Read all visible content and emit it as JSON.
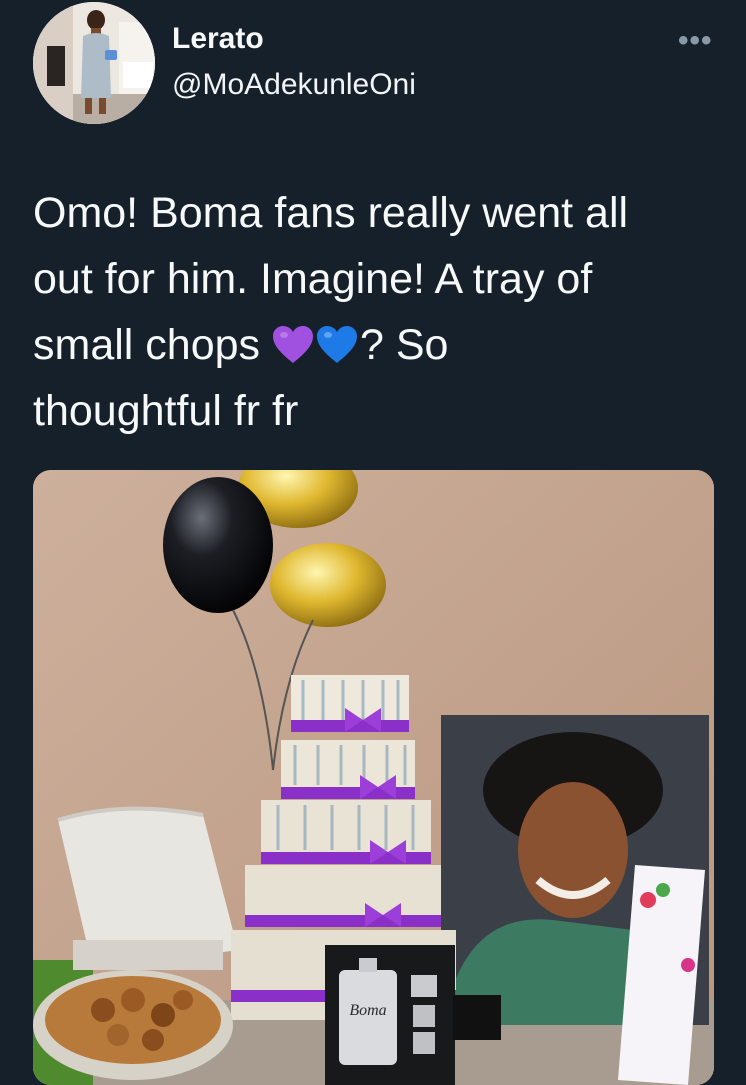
{
  "user": {
    "display_name": "Lerato",
    "handle": "@MoAdekunleOni"
  },
  "tweet": {
    "line1": "Omo! Boma fans really went all",
    "line2": "out for him. Imagine! A tray of",
    "line3_before": "small chops ",
    "emoji": [
      "purple-heart-icon",
      "blue-heart-icon"
    ],
    "line3_after": "? So",
    "line4": "thoughtful fr fr"
  },
  "media": {
    "flask_engraving": "Boma"
  },
  "colors": {
    "background": "#15202b",
    "text": "#f7f9f9",
    "secondary": "#8b98a5",
    "purple_heart": "#a051e0",
    "blue_heart": "#1d7ae6",
    "ribbon": "#8b2fc9"
  }
}
